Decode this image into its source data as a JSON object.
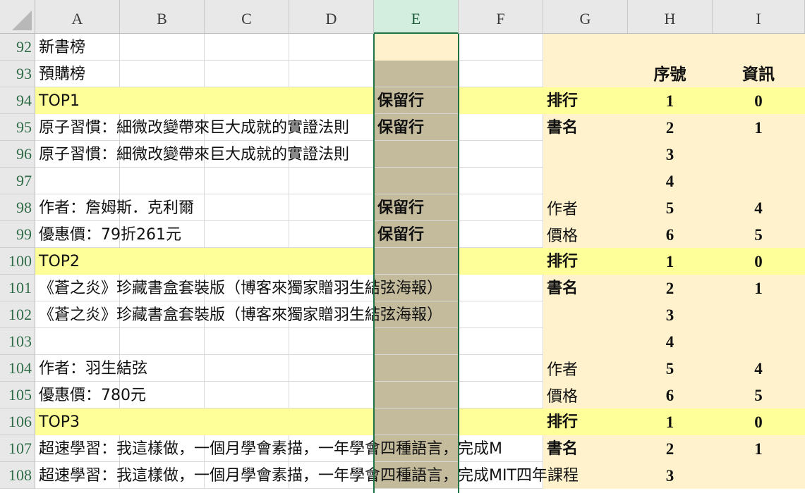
{
  "columns": [
    "A",
    "B",
    "C",
    "D",
    "E",
    "F",
    "G",
    "H",
    "I"
  ],
  "selected_column": "E",
  "rows": [
    {
      "num": "92",
      "a": "新書榜",
      "e": "",
      "g": "",
      "h": "",
      "i": ""
    },
    {
      "num": "93",
      "a": "預購榜",
      "e": "",
      "g": "",
      "h": "序號",
      "i": "資訊"
    },
    {
      "num": "94",
      "a": "TOP1",
      "e": "保留行",
      "g": "排行",
      "h": "1",
      "i": "0"
    },
    {
      "num": "95",
      "a": "原子習慣：細微改變帶來巨大成就的實證法則",
      "e": "保留行",
      "g": "書名",
      "h": "2",
      "i": "1"
    },
    {
      "num": "96",
      "a": "原子習慣：細微改變帶來巨大成就的實證法則",
      "e": "",
      "g": "",
      "h": "3",
      "i": ""
    },
    {
      "num": "97",
      "a": "",
      "e": "",
      "g": "",
      "h": "4",
      "i": ""
    },
    {
      "num": "98",
      "a": "作者：詹姆斯．克利爾",
      "e": "保留行",
      "g": "作者",
      "h": "5",
      "i": "4"
    },
    {
      "num": "99",
      "a": "優惠價：79折261元",
      "e": "保留行",
      "g": "價格",
      "h": "6",
      "i": "5"
    },
    {
      "num": "100",
      "a": "TOP2",
      "e": "",
      "g": "排行",
      "h": "1",
      "i": "0"
    },
    {
      "num": "101",
      "a": "《蒼之炎》珍藏書盒套裝版（博客來獨家贈羽生結弦海報）",
      "e": "",
      "g": "書名",
      "h": "2",
      "i": "1"
    },
    {
      "num": "102",
      "a": "《蒼之炎》珍藏書盒套裝版（博客來獨家贈羽生結弦海報）",
      "e": "",
      "g": "",
      "h": "3",
      "i": ""
    },
    {
      "num": "103",
      "a": "",
      "e": "",
      "g": "",
      "h": "4",
      "i": ""
    },
    {
      "num": "104",
      "a": "作者：羽生結弦",
      "e": "",
      "g": "作者",
      "h": "5",
      "i": "4"
    },
    {
      "num": "105",
      "a": "優惠價：780元",
      "e": "",
      "g": "價格",
      "h": "6",
      "i": "5"
    },
    {
      "num": "106",
      "a": "TOP3",
      "e": "",
      "g": "排行",
      "h": "1",
      "i": "0"
    },
    {
      "num": "107",
      "a": "超速學習：我這樣做，一個月學會素描，一年學會四種語言，完成M",
      "e": "",
      "g": "書名",
      "h": "2",
      "i": "1"
    },
    {
      "num": "108",
      "a": "超速學習：我這樣做，一個月學會素描，一年學會四種語言，完成MIT四年課程",
      "e": "",
      "g": "",
      "h": "3",
      "i": ""
    }
  ]
}
